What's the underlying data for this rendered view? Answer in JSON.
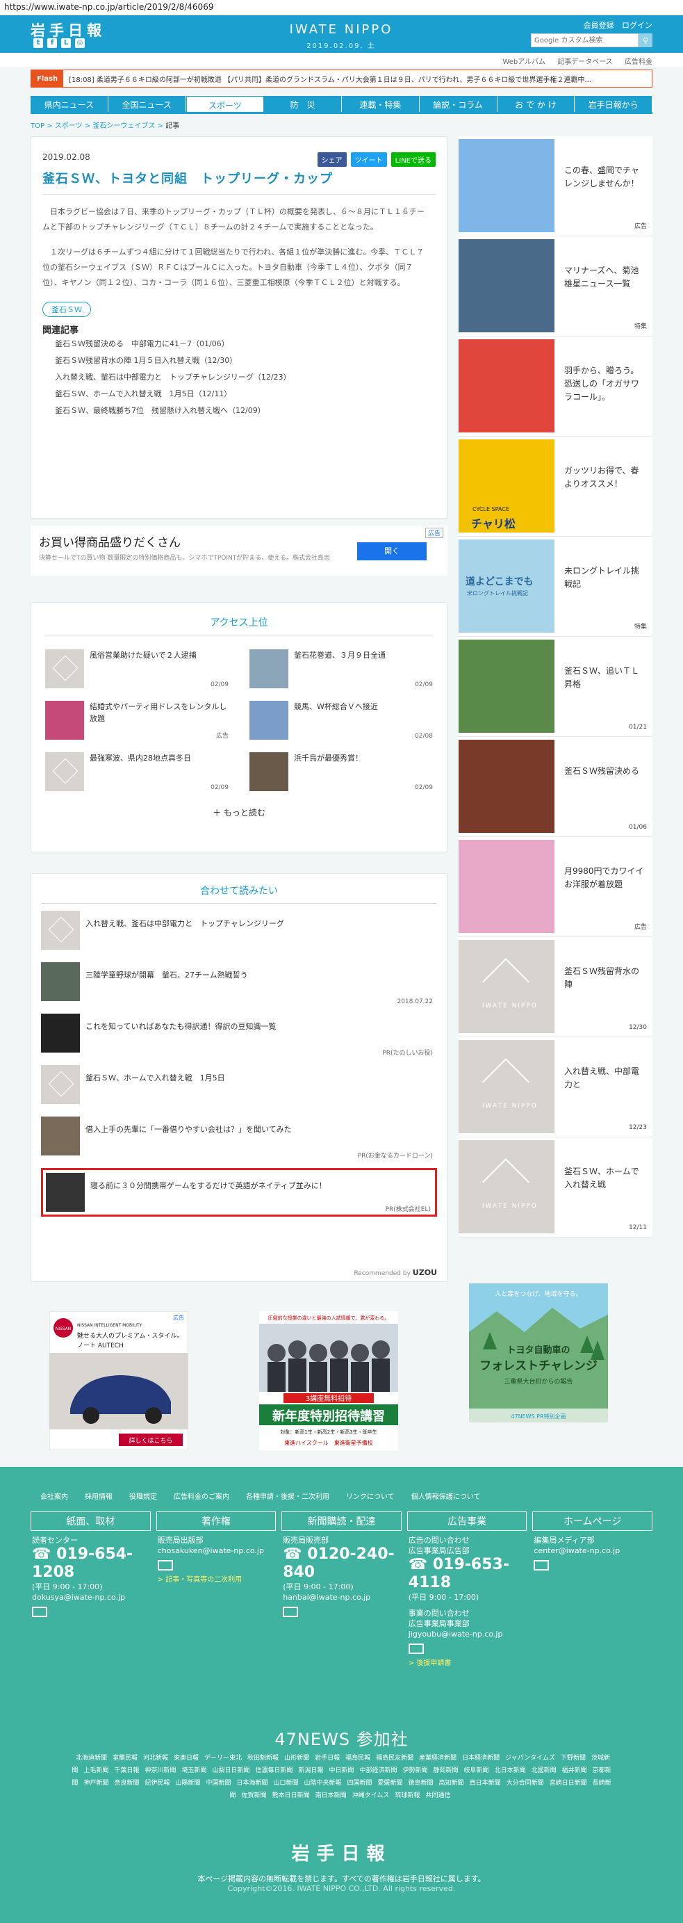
{
  "url": "https://www.iwate-np.co.jp/article/2019/2/8/46069",
  "header": {
    "logo_left": "岩手日報",
    "logo_center": "IWATE NIPPO",
    "date": "2019.02.09. 土",
    "register": "会員登録",
    "login": "ログイン",
    "search_placeholder": "Google カスタム検索"
  },
  "subnav": [
    "Webアルバム",
    "記事データベース",
    "広告料金"
  ],
  "flash": {
    "label": "Flash",
    "text": "[18:08] 柔道男子６６キロ級の阿部一が初戦敗退 【パリ共同】柔道のグランドスラム・パリ大会第１日は９日、パリで行われ、男子６６キロ級で世界選手権２連覇中…"
  },
  "nav": [
    "県内ニュース",
    "全国ニュース",
    "スポーツ",
    "防　災",
    "連載・特集",
    "論説・コラム",
    "お で か け",
    "岩手日報から"
  ],
  "breadcrumb": {
    "top": "TOP",
    "sports": "スポーツ",
    "team": "釜石シーウェイブス",
    "current": "記事"
  },
  "article": {
    "date": "2019.02.08",
    "share_fb": "シェア",
    "share_tw": "ツイート",
    "share_line": "LINEで送る",
    "title": "釜石ＳＷ、トヨタと同組　トップリーグ・カップ",
    "p1": "日本ラグビー協会は７日、来季のトップリーグ・カップ（ＴＬ杯）の概要を発表し、６～８月にＴＬ１６チームと下部のトップチャレンジリーグ（ＴＣＬ）８チームの計２４チームで実施することとなった。",
    "p2": "１次リーグは６チームずつ４組に分けて１回戦総当たりで行われ、各組１位が準決勝に進む。今季、ＴＣＬ７位の釜石シーウェイブス（ＳＷ）ＲＦＣはプールＣに入った。トヨタ自動車（今季ＴＬ４位）、クボタ（同７位）、キヤノン（同１２位）、コカ・コーラ（同１６位）、三菱重工相模原（今季ＴＣＬ２位）と対戦する。",
    "tag": "釜石ＳＷ",
    "related_heading": "関連記事",
    "related": [
      "釜石ＳＷ残留決める　中部電力に41－7（01/06）",
      "釜石ＳＷ残留背水の陣 1月５日入れ替え戦（12/30）",
      "入れ替え戦、釜石は中部電力と　トップチャレンジリーグ（12/23）",
      "釜石ＳＷ、ホームで入れ替え戦　1月5日（12/11）",
      "釜石ＳＷ、最終戦勝ち7位　残留懸け入れ替え戦へ（12/09）"
    ]
  },
  "textad": {
    "badge": "広告",
    "headline": "お買い得商品盛りだくさん",
    "sub": "決算セールでTの買い物 数量限定の特別価格商品も。シマホでTPOINTが貯まる、使える。株式会社島忠",
    "button": "開く"
  },
  "ranking": {
    "heading": "アクセス上位",
    "items": [
      {
        "title": "風俗営業助けた疑いで２人逮捕",
        "date": "02/09",
        "thumb": "placeholder"
      },
      {
        "title": "釜石花巻道、３月９日全通",
        "date": "02/09",
        "thumb": "road"
      },
      {
        "title": "結婚式やパーティ用ドレスをレンタルし放題",
        "date": "広告",
        "thumb": "dress"
      },
      {
        "title": "競馬、W杯総合Ｖへ接近",
        "date": "02/08",
        "thumb": "ski"
      },
      {
        "title": "最強寒波、県内28地点真冬日",
        "date": "02/09",
        "thumb": "placeholder"
      },
      {
        "title": "浜千鳥が最優秀賞！",
        "date": "02/09",
        "thumb": "people"
      }
    ],
    "more": "もっと読む"
  },
  "together": {
    "heading": "合わせて読みたい",
    "items": [
      {
        "title": "入れ替え戦、釜石は中部電力と　トップチャレンジリーグ",
        "meta": ""
      },
      {
        "title": "三陸学童野球が開幕　釜石、27チーム熱戦誓う",
        "meta": "2018.07.22"
      },
      {
        "title": "これを知っていればあなたも得訳通！得訳の豆知識一覧",
        "meta": "PR(たのしいお役)"
      },
      {
        "title": "釜石ＳＷ、ホームで入れ替え戦　1月5日",
        "meta": ""
      },
      {
        "title": "借入上手の先輩に「一番借りやすい会社は？」を聞いてみた",
        "meta": "PR(お金なるカードローン)"
      },
      {
        "title": "寝る前に３０分間携帯ゲームをするだけで英語がネイティブ並みに！",
        "meta": "PR(株式会社EL)"
      }
    ],
    "recommended": "Recommended by",
    "brand": "UZOU"
  },
  "banners": {
    "nissan_tag": "広告",
    "nissan_brand": "NISSAN",
    "nissan_line1": "NISSAN INTELLIGENT MOBILITY",
    "nissan_copy": "魅せる大人のプレミアム・スタイル。",
    "nissan_model": "ノート AUTECH",
    "nissan_btn": "詳しくはこちら",
    "juku_top": "圧倒的な授業の違いと最強の入試情報で、君が変わる。",
    "juku_mid": "3講座無料招待",
    "juku_big": "新年度特別招待講習",
    "juku_sub": "対象：新高1生・新高2生・新高3生・既卒生",
    "juku_brand": "東進ハイスクール　東進衛星予備校",
    "toyota_top": "人と森をつなげ、地域を守る。",
    "toyota_main": "トヨタ自動車の",
    "toyota_main2": "フォレストチャレンジ",
    "toyota_sub": "三重県大台町からの報告",
    "toyota_foot": "47NEWS PR特別企画"
  },
  "sidebar": [
    {
      "text": "この春、盛岡でチャレンジしませんか！",
      "meta": "広告",
      "img": "blue"
    },
    {
      "text": "マリナーズへ、菊池雄星ニュース一覧",
      "meta": "特集",
      "img": "baseball"
    },
    {
      "text": "羽手から、贈ろう。恐送しの「オガサワラコール」。",
      "meta": "",
      "img": "flyer"
    },
    {
      "text": "ガッツリお得で、春よりオススメ！",
      "meta": "",
      "img": "chari"
    },
    {
      "text": "未ロングトレイル挑戦記",
      "meta": "特集",
      "img": "trail"
    },
    {
      "text": "釜石ＳＷ、追いＴＬ昇格",
      "meta": "01/21",
      "img": "rugby"
    },
    {
      "text": "釜石ＳＷ残留決める",
      "meta": "01/06",
      "img": "rugby2"
    },
    {
      "text": "月9980円でカワイイお洋服が着放題",
      "meta": "広告",
      "img": "girls"
    },
    {
      "text": "釜石ＳＷ残留背水の陣",
      "meta": "12/30",
      "img": "placeholder"
    },
    {
      "text": "入れ替え戦、中部電力と",
      "meta": "12/23",
      "img": "placeholder"
    },
    {
      "text": "釜石ＳＷ、ホームで入れ替え戦",
      "meta": "12/11",
      "img": "placeholder"
    }
  ],
  "sidebar_labels": {
    "chari_top": "CYCLE SPACE",
    "chari_name": "チャリ松",
    "trail": "道よどこまでも",
    "trail_sub": "米ロングトレイル挑戦記",
    "placeholder_logo": "IWATE NIPPO"
  },
  "footer": {
    "links": [
      "会社案内",
      "採用情報",
      "役職規定",
      "広告料金のご案内",
      "各種申請・後援・二次利用",
      "リンクについて",
      "個人情報保護について"
    ],
    "cols": [
      {
        "h": "紙面、取材",
        "l1": "読者センター",
        "phone": "019-654-1208",
        "hours": "(平日 9:00 - 17:00)",
        "mail": "dokusya@iwate-np.co.jp"
      },
      {
        "h": "著作権",
        "l1": "販売局出版部",
        "mail": "chosakuken@iwate-np.co.jp",
        "link": "> 記事・写真等の二次利用"
      },
      {
        "h": "新聞購読・配達",
        "l1": "販売局販売部",
        "phone": "0120-240-840",
        "hours": "(平日 9:00 - 17:00)",
        "mail": "hanbai@iwate-np.co.jp"
      },
      {
        "h": "広告事業",
        "l1": "広告の問い合わせ",
        "l2": "広告事業局広告部",
        "phone": "019-653-4118",
        "hours": "(平日 9:00 - 17:00)",
        "l3": "事業の問い合わせ",
        "l4": "広告事業局事業部",
        "mail": "jigyoubu@iwate-np.co.jp",
        "link": "> 後援申請書"
      },
      {
        "h": "ホームページ",
        "l1": "編集局メディア部",
        "mail": "center@iwate-np.co.jp"
      }
    ],
    "news47": "47NEWS 参加社",
    "papers": [
      "北海道新聞",
      "室蘭民報",
      "河北新報",
      "東奥日報",
      "デーリー東北",
      "秋田魁新報",
      "山形新聞",
      "岩手日報",
      "福島民報",
      "福島民友新聞",
      "産業経済新聞",
      "日本経済新聞",
      "ジャパンタイムズ",
      "下野新聞",
      "茨城新聞",
      "上毛新聞",
      "千葉日報",
      "神奈川新聞",
      "埼玉新聞",
      "山梨日日新聞",
      "信濃毎日新聞",
      "新潟日報",
      "中日新聞",
      "中部経済新聞",
      "伊勢新聞",
      "静岡新聞",
      "岐阜新聞",
      "北日本新聞",
      "北國新聞",
      "福井新聞",
      "京都新聞",
      "神戸新聞",
      "奈良新聞",
      "紀伊民報",
      "山陽新聞",
      "中国新聞",
      "日本海新聞",
      "山口新聞",
      "山陰中央新報",
      "四国新聞",
      "愛媛新聞",
      "徳島新聞",
      "高知新聞",
      "西日本新聞",
      "大分合同新聞",
      "宮崎日日新聞",
      "長崎新聞",
      "佐賀新聞",
      "熊本日日新聞",
      "南日本新聞",
      "沖縄タイムス",
      "琉球新報",
      "共同通信"
    ],
    "logo": "岩手日報",
    "note": "本ページ掲載内容の無断転載を禁じます。すべての著作権は岩手日報社に属します。",
    "copyright": "Copyright©2016. IWATE NIPPO CO.,LTD. All rights reserved."
  },
  "colors": {
    "brand": "#1a9fcf",
    "flash": "#e6531e",
    "footer": "#3fb2a0",
    "highlight": "#e02020"
  }
}
